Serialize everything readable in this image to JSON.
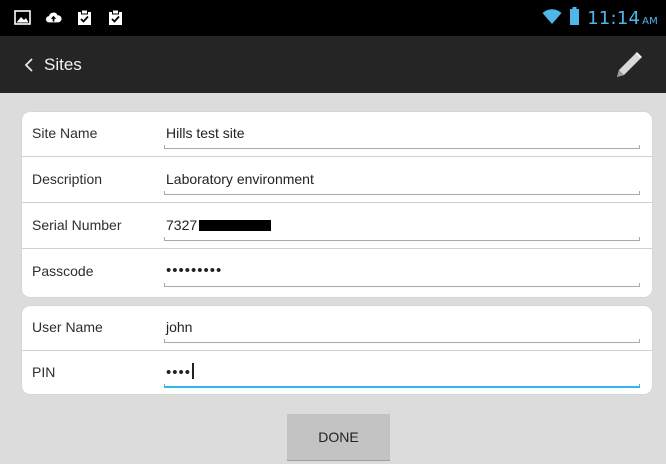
{
  "status_bar": {
    "time": "11:14",
    "ampm": "AM",
    "left_icons": [
      "image-icon",
      "cloud-upload-icon",
      "clipboard-check-icon",
      "clipboard-check-icon"
    ],
    "right_icons": [
      "wifi-icon",
      "battery-icon"
    ]
  },
  "header": {
    "back_label": "Sites",
    "back_icon": "chevron-left-icon",
    "edit_icon": "pencil-icon"
  },
  "site_form": {
    "site_name": {
      "label": "Site Name",
      "value": "Hills test site"
    },
    "description": {
      "label": "Description",
      "value": "Laboratory environment"
    },
    "serial_number": {
      "label": "Serial Number",
      "value": "7327",
      "redacted": true
    },
    "passcode": {
      "label": "Passcode",
      "value": "•••••••••"
    }
  },
  "user_form": {
    "user_name": {
      "label": "User Name",
      "value": "john"
    },
    "pin": {
      "label": "PIN",
      "value": "••••"
    }
  },
  "done_button": {
    "label": "DONE"
  },
  "colors": {
    "status_bar_bg": "#000000",
    "action_bar_bg": "#252525",
    "page_bg": "#dcdcdc",
    "card_bg": "#ffffff",
    "accent": "#33b5e5",
    "time_color": "#4fb6ea"
  }
}
